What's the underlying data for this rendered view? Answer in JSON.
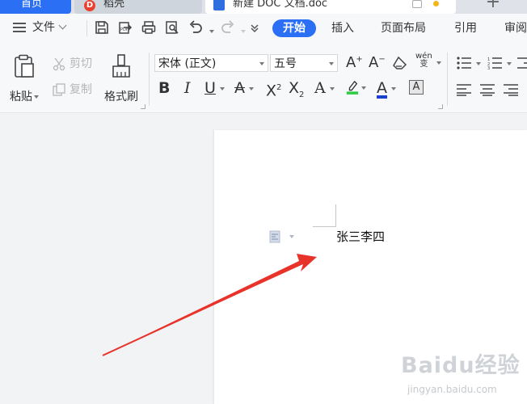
{
  "window": {
    "tabs": [
      {
        "label": "首页",
        "active": false
      },
      {
        "label": "稻壳",
        "active": false
      },
      {
        "label": "新建 DOC 文档.doc",
        "active": true
      }
    ],
    "add_tab_label": "+"
  },
  "ribbon": {
    "file_menu_label": "文件",
    "quick_access_icons": [
      "save-icon",
      "export-icon",
      "print-icon",
      "print-preview-icon",
      "undo-icon",
      "redo-icon",
      "customize-icon"
    ],
    "tabs": [
      "开始",
      "插入",
      "页面布局",
      "引用",
      "审阅"
    ],
    "active_tab": "开始",
    "clipboard": {
      "paste_label": "粘贴",
      "cut_label": "剪切",
      "copy_label": "复制",
      "format_painter_label": "格式刷"
    },
    "font": {
      "family": "宋体 (正文)",
      "size": "五号",
      "phonetic_label": "wén\n变"
    },
    "accent_color": "#2b6ff5",
    "highlight_color": "#2ecc40",
    "font_color": "#1b3fd1"
  },
  "document": {
    "text": "张三李四"
  },
  "watermark": {
    "brand": "Baidu经验",
    "url": "jingyan.baidu.com"
  },
  "annotation": {
    "arrow_color": "#e8332a"
  }
}
